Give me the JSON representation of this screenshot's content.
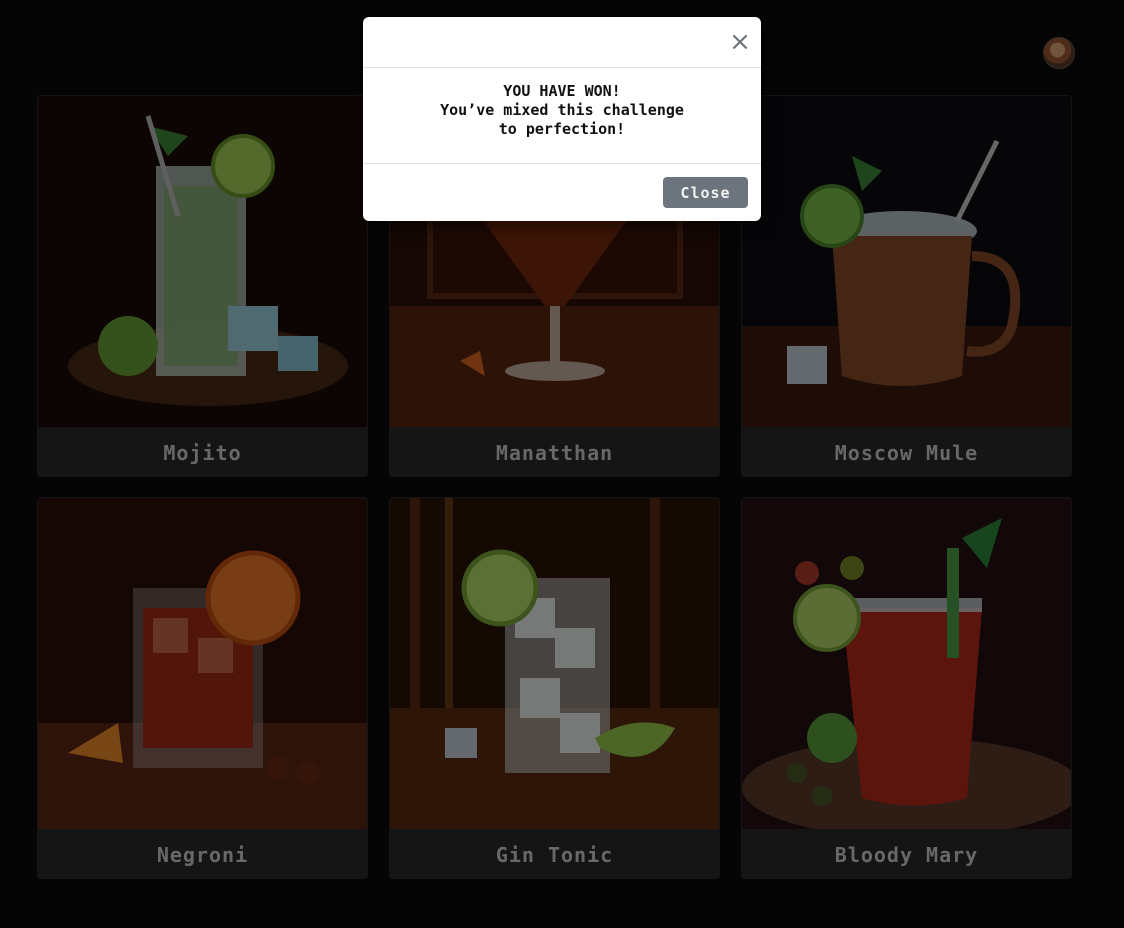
{
  "page": {
    "background": "#0b0b0b"
  },
  "header": {
    "avatar_icon": "user-avatar-icon"
  },
  "cocktails": [
    {
      "name": "Mojito",
      "icon": "mojito-image"
    },
    {
      "name": "Manatthan",
      "icon": "manhattan-image"
    },
    {
      "name": "Moscow Mule",
      "icon": "moscow-mule-image"
    },
    {
      "name": "Negroni",
      "icon": "negroni-image"
    },
    {
      "name": "Gin Tonic",
      "icon": "gin-tonic-image"
    },
    {
      "name": "Bloody Mary",
      "icon": "bloody-mary-image"
    }
  ],
  "modal": {
    "title_line": "YOU HAVE WON!",
    "message_line1": "You’ve mixed this challenge",
    "message_line2": "to perfection!",
    "close_label": "Close",
    "close_icon": "×",
    "button_color": "#6c757d"
  }
}
